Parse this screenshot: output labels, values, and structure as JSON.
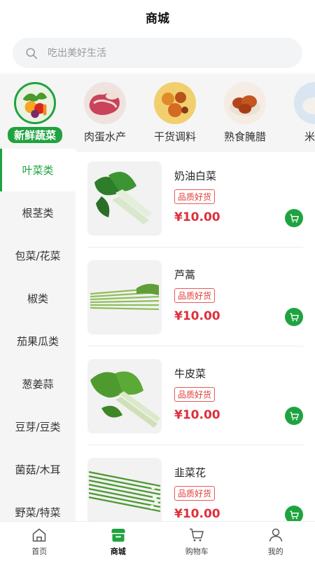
{
  "header": {
    "title": "商城"
  },
  "search": {
    "placeholder": "吃出美好生活"
  },
  "categories": [
    {
      "label": "新鲜蔬菜",
      "icon": "vegetables-icon",
      "active": true
    },
    {
      "label": "肉蛋水产",
      "icon": "meat-icon",
      "active": false
    },
    {
      "label": "干货调料",
      "icon": "spices-icon",
      "active": false
    },
    {
      "label": "熟食腌腊",
      "icon": "cooked-food-icon",
      "active": false
    },
    {
      "label": "米面",
      "icon": "rice-noodle-icon",
      "active": false
    }
  ],
  "sidebar": {
    "items": [
      {
        "label": "叶菜类",
        "active": true
      },
      {
        "label": "根茎类"
      },
      {
        "label": "包菜/花菜"
      },
      {
        "label": "椒类"
      },
      {
        "label": "茄果瓜类"
      },
      {
        "label": "葱姜蒜"
      },
      {
        "label": "豆芽/豆类"
      },
      {
        "label": "菌菇/木耳"
      },
      {
        "label": "野菜/特菜"
      }
    ]
  },
  "products": [
    {
      "name": "奶油白菜",
      "tag": "品质好货",
      "price": "¥10.00",
      "image": "bok-choy-image"
    },
    {
      "name": "芦蒿",
      "tag": "品质好货",
      "price": "¥10.00",
      "image": "artemisia-image"
    },
    {
      "name": "牛皮菜",
      "tag": "品质好货",
      "price": "¥10.00",
      "image": "chard-image"
    },
    {
      "name": "韭菜花",
      "tag": "品质好货",
      "price": "¥10.00",
      "image": "chive-flower-image"
    }
  ],
  "tabbar": {
    "items": [
      {
        "label": "首页",
        "icon": "home-icon"
      },
      {
        "label": "商城",
        "icon": "mall-icon",
        "active": true
      },
      {
        "label": "购物车",
        "icon": "cart-icon"
      },
      {
        "label": "我的",
        "icon": "user-icon"
      }
    ]
  },
  "colors": {
    "accent": "#1fa340",
    "price": "#e02f3b",
    "tag": "#e33b3b"
  }
}
